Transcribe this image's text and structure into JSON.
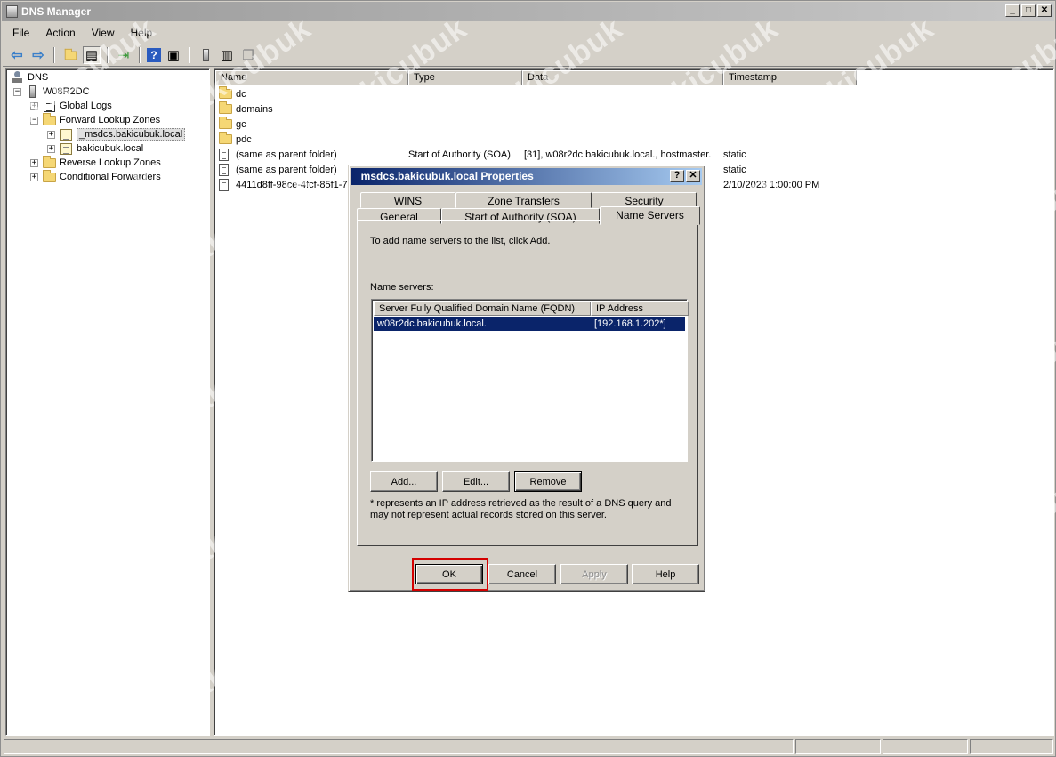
{
  "window": {
    "title": "DNS Manager",
    "controls": {
      "minimize": "_",
      "maximize": "□",
      "close": "✕"
    }
  },
  "menu": [
    "File",
    "Action",
    "View",
    "Help"
  ],
  "toolbar_icons": [
    "back-arrow-icon",
    "forward-arrow-icon",
    "up-folder-icon",
    "show-hide-tree-icon",
    "export-list-icon",
    "help-icon",
    "properties-icon",
    "server-icon",
    "list-icon",
    "copy-icon"
  ],
  "tree": {
    "root": "DNS",
    "server": "W08R2DC",
    "global_logs": "Global Logs",
    "forward_zones": "Forward Lookup Zones",
    "zone_msdcs": "_msdcs.bakicubuk.local",
    "zone_main": "bakicubuk.local",
    "reverse_zones": "Reverse Lookup Zones",
    "conditional_forwarders": "Conditional Forwarders",
    "expand_open": "−",
    "expand_closed": "+"
  },
  "list": {
    "columns": [
      "Name",
      "Type",
      "Data",
      "Timestamp"
    ],
    "rows": [
      {
        "name": "dc",
        "type": "",
        "data": "",
        "timestamp": "",
        "icon": "folder"
      },
      {
        "name": "domains",
        "type": "",
        "data": "",
        "timestamp": "",
        "icon": "folder"
      },
      {
        "name": "gc",
        "type": "",
        "data": "",
        "timestamp": "",
        "icon": "folder"
      },
      {
        "name": "pdc",
        "type": "",
        "data": "",
        "timestamp": "",
        "icon": "folder"
      },
      {
        "name": "(same as parent folder)",
        "type": "Start of Authority (SOA)",
        "data": "[31], w08r2dc.bakicubuk.local., hostmaster.",
        "timestamp": "static",
        "icon": "record"
      },
      {
        "name": "(same as parent folder)",
        "type": "",
        "data": "",
        "timestamp": "static",
        "icon": "record"
      },
      {
        "name": "4411d8ff-98ce-4fcf-85f1-7",
        "type": "",
        "data": "",
        "timestamp": "2/10/2023 1:00:00 PM",
        "icon": "record"
      }
    ]
  },
  "dialog": {
    "title": "_msdcs.bakicubuk.local Properties",
    "help_btn": "?",
    "close_btn": "✕",
    "tabs_top": [
      "WINS",
      "Zone Transfers",
      "Security"
    ],
    "tabs_bottom": [
      "General",
      "Start of Authority (SOA)",
      "Name Servers"
    ],
    "active_tab": "Name Servers",
    "instruction": "To add name servers to the list, click Add.",
    "list_label": "Name servers:",
    "ns_columns": [
      "Server Fully Qualified Domain Name (FQDN)",
      "IP Address"
    ],
    "ns_rows": [
      {
        "fqdn": "w08r2dc.bakicubuk.local.",
        "ip": "[192.168.1.202*]"
      }
    ],
    "buttons": {
      "add": "Add...",
      "edit": "Edit...",
      "remove": "Remove"
    },
    "footnote": "* represents an IP address retrieved as the result of a DNS query and may not represent actual records stored on this server.",
    "footer": {
      "ok": "OK",
      "cancel": "Cancel",
      "apply": "Apply",
      "help": "Help"
    }
  },
  "watermark": "bakicubuk",
  "colors": {
    "selection": "#0a246a",
    "highlight_box": "#d40000",
    "dialog_title": "#0a246a"
  }
}
